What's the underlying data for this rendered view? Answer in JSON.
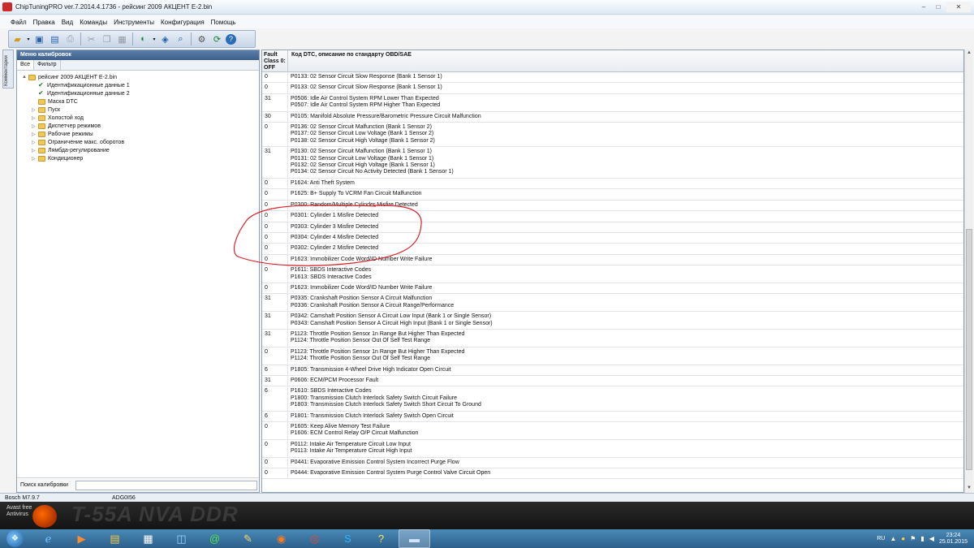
{
  "window": {
    "title": "ChipTuningPRO ver.7.2014.4.1736 - рейсинг 2009  АКЦЕНТ E-2.bin",
    "min": "–",
    "max": "□",
    "close": "✕"
  },
  "menu": [
    "Файл",
    "Правка",
    "Вид",
    "Команды",
    "Инструменты",
    "Конфигурация",
    "Помощь"
  ],
  "side_tab": "Комментарии",
  "left_pane": {
    "header": "Меню калибровок",
    "tabs": [
      "Все",
      "Фильтр"
    ],
    "tree": [
      {
        "label": "рейсинг 2009  АКЦЕНТ E-2.bin",
        "level": 0,
        "type": "folder",
        "exp": "▲"
      },
      {
        "label": "Идентификационные данные 1",
        "level": 1,
        "type": "check",
        "exp": ""
      },
      {
        "label": "Идентификационные данные 2",
        "level": 1,
        "type": "check",
        "exp": ""
      },
      {
        "label": "Маска DTC",
        "level": 1,
        "type": "folder",
        "exp": ""
      },
      {
        "label": "Пуск",
        "level": 1,
        "type": "folder",
        "exp": "▷"
      },
      {
        "label": "Холостой ход",
        "level": 1,
        "type": "folder",
        "exp": "▷"
      },
      {
        "label": "Диспетчер режимов",
        "level": 1,
        "type": "folder",
        "exp": "▷"
      },
      {
        "label": "Рабочие режимы",
        "level": 1,
        "type": "folder",
        "exp": "▷"
      },
      {
        "label": "Ограничение макс. оборотов",
        "level": 1,
        "type": "folder",
        "exp": "▷"
      },
      {
        "label": "Лямбда-регулирование",
        "level": 1,
        "type": "folder",
        "exp": "▷"
      },
      {
        "label": "Кондиционер",
        "level": 1,
        "type": "folder",
        "exp": "▷"
      }
    ],
    "search_label": "Поиск калибровки",
    "search_value": ""
  },
  "grid": {
    "col1_header": "Fault Class 0: OFF",
    "col2_header": "Код DTC, описание по стандарту OBD/SAE",
    "rows": [
      {
        "fc": "0",
        "desc": "P0133: 02 Sensor Circuit Slow Response (Bank 1 Sensor 1)"
      },
      {
        "fc": "0",
        "desc": "P0133: 02 Sensor Circuit Slow Response (Bank 1 Sensor 1)"
      },
      {
        "fc": "31",
        "desc": "P0506: Idle Air Control System RPM Lower Than Expected\nP0507: Idle Air Control System RPM Higher Than Expected"
      },
      {
        "fc": "30",
        "desc": "P0105: Manifold Absolute Pressure/Barometric Pressure Circuit Malfunction"
      },
      {
        "fc": "0",
        "desc": "P0136: 02 Sensor Circuit Malfunction (Bank 1 Sensor 2)\nP0137: 02 Sensor Circuit Low Voltage (Bank 1 Sensor 2)\nP0138: 02 Sensor Circuit High Voltage (Bank 1 Sensor 2)"
      },
      {
        "fc": "31",
        "desc": "P0130: 02 Sensor Circuit Malfunction (Bank 1 Sensor 1)\nP0131: 02 Sensor Circuit Low Voltage (Bank 1 Sensor 1)\nP0132: 02 Sensor Circuit High Voltage (Bank 1 Sensor 1)\nP0134: 02 Sensor Circuit No Activity Detected (Bank 1 Sensor 1)"
      },
      {
        "fc": "0",
        "desc": "P1624: Anti Theft System"
      },
      {
        "fc": "0",
        "desc": "P1625: B+ Supply To VCRM Fan Circuit Malfunction"
      },
      {
        "fc": "0",
        "desc": "P0300: Random/Multiple Cylinder Misfire Detected"
      },
      {
        "fc": "0",
        "desc": "P0301: Cylinder 1 Misfire Detected"
      },
      {
        "fc": "0",
        "desc": "P0303: Cylinder 3 Misfire Detected"
      },
      {
        "fc": "0",
        "desc": "P0304: Cylinder 4 Misfire Detected"
      },
      {
        "fc": "0",
        "desc": "P0302: Cylinder 2 Misfire Detected"
      },
      {
        "fc": "0",
        "desc": "P1623: Immobilizer Code Word/ID Number Write Failure"
      },
      {
        "fc": "0",
        "desc": "P1611: SBDS Interactive Codes\nP1613: SBDS Interactive Codes"
      },
      {
        "fc": "0",
        "desc": "P1623: Immobilizer Code Word/ID Number Write Failure"
      },
      {
        "fc": "31",
        "desc": "P0335: Crankshaft Position Sensor A Circuit Malfunction\nP0336: Crankshaft Position Sensor A Circuit Range/Performance"
      },
      {
        "fc": "31",
        "desc": "P0342: Camshaft Position Sensor A Circuit Low Input (Bank 1 or Single Sensor)\nP0343: Camshaft Position Sensor A Circuit High Input (Bank 1 or Single Sensor)"
      },
      {
        "fc": "31",
        "desc": "P1123: Throttle Position Sensor 1n Range But Higher Than Expected\nP1124: Throttle Position Sensor Out Of Self Test Range"
      },
      {
        "fc": "0",
        "desc": "P1123: Throttle Position Sensor 1n Range But Higher Than Expected\nP1124: Throttle Position Sensor Out Of Self Test Range"
      },
      {
        "fc": "6",
        "desc": "P1805: Transmission 4-Wheel Drive High Indicator Open Circuit"
      },
      {
        "fc": "31",
        "desc": "P0606: ECM/PCM Processor Fault"
      },
      {
        "fc": "6",
        "desc": "P1610: SBDS Interactive Codes\nP1800: Transmission Clutch Interlock Safety Switch Circuit Failure\nP1803: Transmission Clutch Interlock Safety Switch Short Circuit To Ground"
      },
      {
        "fc": "6",
        "desc": "P1801: Transmission Clutch Interlock Safety Switch Open Circuit"
      },
      {
        "fc": "0",
        "desc": "P1605: Keep Alive Memory Test Failure\nP1606: ECM Control Relay O/P Circuit Malfunction"
      },
      {
        "fc": "0",
        "desc": "P0112: Intake Air Temperature Circuit Low Input\nP0113: Intake Air Temperature Circuit High Input"
      },
      {
        "fc": "0",
        "desc": "P0441: Evaporative Emission Control System Incorrect Purge Flow"
      },
      {
        "fc": "0",
        "desc": "P0444: Evaporative Emission Control System Purge Control Valve Circuit Open"
      }
    ]
  },
  "status": {
    "ecu": "Bosch M7.9.7",
    "sw": "ADG0I56"
  },
  "desktop": {
    "avast_line1": "Avast free",
    "avast_line2": "Antivirus",
    "wallpaper_text": "T-55A NVA DDR"
  },
  "taskbar": {
    "start_icon": "windows-logo",
    "icons": [
      "internet-explorer",
      "media-player",
      "file-explorer",
      "calendar-app",
      "app",
      "at-mail",
      "paint",
      "firefox",
      "chrome",
      "skype",
      "unknown-app",
      "chiptuning"
    ],
    "language": "RU",
    "time": "23:24",
    "date": "25.01.2015"
  },
  "colors": {
    "annotation": "#d8222a",
    "pane_header": "#4a6c98",
    "taskbar": "#3a75a3"
  }
}
